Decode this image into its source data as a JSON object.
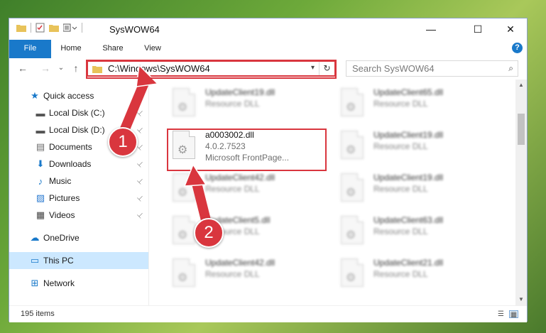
{
  "window": {
    "title": "SysWOW64",
    "controls": {
      "minimize": "—",
      "maximize": "☐",
      "close": "✕"
    }
  },
  "ribbon": {
    "tabs": [
      "File",
      "Home",
      "Share",
      "View"
    ],
    "help": "?"
  },
  "navigation": {
    "back": "←",
    "forward": "→",
    "recent": "⌄",
    "up": "↑",
    "address": "C:\\Windows\\SysWOW64",
    "address_dropdown": "▾",
    "refresh": "↻",
    "search_placeholder": "Search SysWOW64",
    "search_icon": "⌕"
  },
  "sidebar": {
    "items": [
      {
        "label": "Quick access",
        "icon": "star-icon",
        "glyph": "★",
        "color": "#1979ca",
        "pinned": false
      },
      {
        "label": "Local Disk (C:)",
        "icon": "drive-icon",
        "glyph": "▬",
        "color": "#555555",
        "pinned": true
      },
      {
        "label": "Local Disk (D:)",
        "icon": "drive-icon",
        "glyph": "▬",
        "color": "#555555",
        "pinned": true
      },
      {
        "label": "Documents",
        "icon": "document-icon",
        "glyph": "▤",
        "color": "#6b6b6b",
        "pinned": true
      },
      {
        "label": "Downloads",
        "icon": "download-icon",
        "glyph": "⬇",
        "color": "#1979ca",
        "pinned": true
      },
      {
        "label": "Music",
        "icon": "music-icon",
        "glyph": "♪",
        "color": "#1979ca",
        "pinned": true
      },
      {
        "label": "Pictures",
        "icon": "pictures-icon",
        "glyph": "▨",
        "color": "#2a7ad0",
        "pinned": true
      },
      {
        "label": "Videos",
        "icon": "video-icon",
        "glyph": "▦",
        "color": "#444444",
        "pinned": true
      },
      {
        "label": "OneDrive",
        "icon": "cloud-icon",
        "glyph": "☁",
        "color": "#1979ca",
        "pinned": false
      },
      {
        "label": "This PC",
        "icon": "computer-icon",
        "glyph": "▭",
        "color": "#1979ca",
        "pinned": false
      },
      {
        "label": "Network",
        "icon": "network-icon",
        "glyph": "⊞",
        "color": "#1979ca",
        "pinned": false
      }
    ],
    "selected": "This PC",
    "pin_glyph": "📌"
  },
  "files": [
    {
      "name": "UpdateClient19.dll",
      "line2": "Resource DLL",
      "line3": "",
      "blurred": true
    },
    {
      "name": "UpdateClient65.dll",
      "line2": "Resource DLL",
      "line3": "",
      "blurred": true
    },
    {
      "name": "a0003002.dll",
      "line2": "4.0.2.7523",
      "line3": "Microsoft FrontPage...",
      "blurred": false
    },
    {
      "name": "UpdateClient19.dll",
      "line2": "Resource DLL",
      "line3": "",
      "blurred": true
    },
    {
      "name": "UpdateClient42.dll",
      "line2": "Resource DLL",
      "line3": "",
      "blurred": true
    },
    {
      "name": "UpdateClient19.dll",
      "line2": "Resource DLL",
      "line3": "",
      "blurred": true
    },
    {
      "name": "UpdateClient5.dll",
      "line2": "Resource DLL",
      "line3": "",
      "blurred": true
    },
    {
      "name": "UpdateClient63.dll",
      "line2": "Resource DLL",
      "line3": "",
      "blurred": true
    },
    {
      "name": "UpdateClient42.dll",
      "line2": "Resource DLL",
      "line3": "",
      "blurred": true
    },
    {
      "name": "UpdateClient21.dll",
      "line2": "Resource DLL",
      "line3": "",
      "blurred": true
    }
  ],
  "status": {
    "item_count": "195 items"
  },
  "callouts": {
    "one": "1",
    "two": "2"
  },
  "colors": {
    "accent": "#1979ca",
    "highlight": "#d9363e",
    "selected_bg": "#cce8ff"
  }
}
